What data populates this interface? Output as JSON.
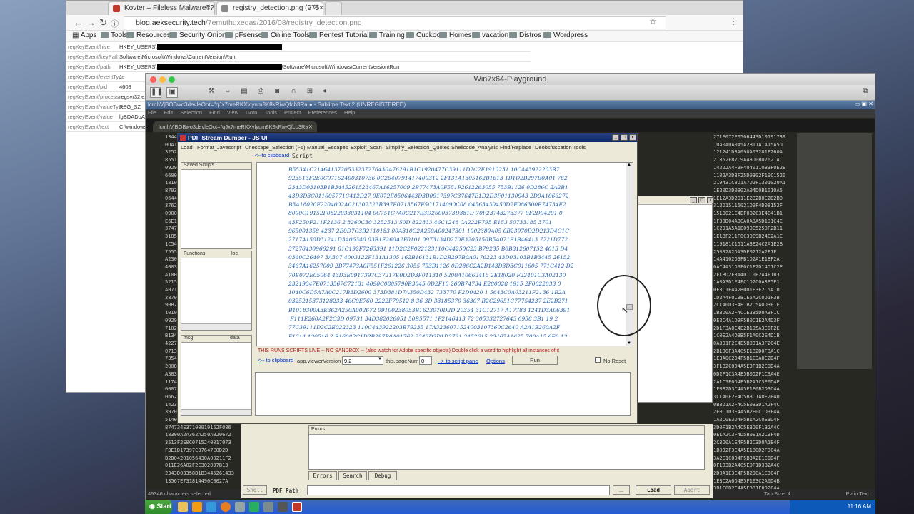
{
  "chrome": {
    "tabs": [
      {
        "label": "Kovter – Fileless Malware?? P"
      },
      {
        "label": "registry_detection.png (975×1"
      }
    ],
    "url_host": "blog.aeksecurity.tech",
    "url_path": "/7emuthuxeqas/2016/08/registry_detection.png",
    "bookmarks": [
      "Apps",
      "Tools",
      "Resources",
      "Security Onion",
      "pFsense",
      "Online Tools",
      "Pentest Tutorials",
      "Training",
      "Cuckoo",
      "Homes",
      "vacation",
      "Distros",
      "Wordpress"
    ],
    "registry_rows": [
      {
        "key": "regKeyEvent/hive",
        "value": "HKEY_USERS\\"
      },
      {
        "key": "regKeyEvent/keyPath",
        "value": "Software\\Microsoft\\Windows\\CurrentVersion\\Run"
      },
      {
        "key": "regKeyEvent/path",
        "value": "HKEY_USERS\\"
      },
      {
        "key": "regKeyEvent/eventType",
        "value": "1"
      },
      {
        "key": "regKeyEvent/pid",
        "value": "4608"
      },
      {
        "key": "regKeyEvent/process",
        "value": "regsvr32.exe"
      },
      {
        "key": "regKeyEvent/valueType",
        "value": "REG_SZ"
      },
      {
        "key": "regKeyEvent/value",
        "value": "lgBDADoA"
      },
      {
        "key": "regKeyEvent/text",
        "value": "C:\\windows"
      }
    ],
    "registry_path_suffix": "\\Software\\Microsoft\\Windows\\CurrentVersion\\Run"
  },
  "vm": {
    "title": "Win7x64-Playground"
  },
  "sublime": {
    "title": "lcmhVjBOBwo3devleOot=\"qJx7meRKXvlyum8K8kRiwQfcb3Ra ● - Sublime Text 2 (UNREGISTERED)",
    "menu": [
      "File",
      "Edit",
      "Selection",
      "Find",
      "View",
      "Goto",
      "Tools",
      "Project",
      "Preferences",
      "Help"
    ],
    "tab": "lcmhVjBOBwo3devleOot=\"qJx7meRKXvlyum8K8kRiwQfcb3Ra",
    "status_left": "49346 characters selected",
    "status_tab": "Tab Size: 4",
    "status_syntax": "Plain Text",
    "left_column": "1344\n0DA1\n3252\n8551\n0929\n6600\n1810\n8793\n0644\n3762\n0900\nE6E1\n3747\n3185\n1C54\n7555\nA230\n4003\nA100\n5215\nA071\n2870\n90B7\n1010\n0929\n7102\nB134\n4227\n0713\n7354\n2008\nA383\n1174\n0007\n0662\n1423\n3970\n5140\n874734E37100919152F086\n18300A2A362A250A020672\n3513F2E0C0715240017073\nF3E1D17397C37647E0D2D\nB2D04201056430A00211F2\n011E26A02F2C302097B13\n2343D03358B1B3445261433\n13567E731814490C0027A",
    "right_column": "271E072E0506443D10191739\n10A0A0A0A5A2B11A1A15A5D\n121241D3A090A03281E260A\n21852F87C9A48D0B07621AC\n14222A4F3F4040110B3F0E2E\n1102A3D3F25D9302F19C1520\n219431C8D1A7D2F1301020A1\n1E20D3D0B02A04D0B1010A5\n1E12A3D2D11E2B2B0E2D2B0\n312D15115021D9F4D0B152F\n151D021C4EF0B2C3E4C41B1\n1F38D04A3CA0A3A5D191C4C\n1C2D1A5A1E09DE5250F2B11\n1E18F211F0C3DE9B24C2A1E\n119181C1511A3E24C2A1E2B\n2509282DA3DE0212A2F1E\n14A4102D3FB1D2A1E18F2A\n0AC4A31D9F0C1F2D14D1C2E\n2F1BD2F3A4D1C0E2A4F1B3\n1A0A3D1E4FC1D2C0A3B5E1\n0F3C1E4A2B0D1F3E2C5A1D\n1D2A4F0C3B1E5A2C0D1F3B\n2C1A0D3F4E1B2C5A0D3E1F\n1B3D0A2F4C1E2B5D0A3F1C\n0E2C4A1D3F5B0C1E2A4D3F\n2D1F3A0C4E2B1D5A3C0F2E\n1C0E2A4D3B5F1A0C2E4D1B\n0A3D1F2C4E5B0D1A3F2C4E\n2B1D0F3A4C5E1B2D0F3A1C\n1E3A0C2D4F5B1E3A0C2D4F\n3F1B2C0D4A5E3F1B2C0D4A\n0D2F1C3A4E5B0D2F1C3A4E\n2A1C3E0D4F5B2A1C3E0D4F\n1F0B2D3C4A5E1F0B2D3C4A\n3C1A0F2E4D5B3C1A0F2E4D\n0B3D1A2F4C5E0B3D1A2F4C\n2E0C1D3F4A5B2E0C1D3F4A\n1A2C0E3D4F5B1A2C0E3D4F\n3D0F1B2A4C5E3D0F1B2A4C\n0E1A2C3F4D5B0E1A2C3F4D\n2C3D0A1E4F5B2C3D0A1E4F\n1B0D2F3C4A5E1B0D2F3C4A\n3A2E1C0D4F5B3A2E1C0D4F\n0F1D3B2A4C5E0F1D3B2A4C\n2D0A1E3C4F5B2D0A1E3C4F\n1E3C2A0D4B5F1E3C2A0D4B\n3B1F0D2C4A5E3B1F0D2C4A"
  },
  "psd": {
    "title": "PDF Stream Dumper - JS UI",
    "menu": [
      "Load",
      "Format_Javascript",
      "Unescape_Selection (F6)",
      "Manual_Escapes",
      "Exploit_Scan",
      "Simplify_Selection_Quotes",
      "Shellcode_Analysis",
      "Find/Replace",
      "Deobsfuscation Tools"
    ],
    "to_clipboard": "<--to clipboard",
    "script_label": "Script",
    "saved_scripts": "Saved Scripts",
    "functions_col": "Functions",
    "loc_col": "loc",
    "msg_col": "msg",
    "data_col": "data",
    "script_lines": "B55341C2146413720533237276430A76291B1C1920477C39111D2C2E1910231 10C443922203B7\n923513F2E0C07152400310736 0C2640791417400312 2F131A1305162B1613 1B1D2B297B0A01 762\n2343D03103B1B3445261523467A16257009 2B77473A0F551F2612263055 753B1126 0D286C 2A2B1\n43D3D3C011605771C412D27 0E072E0506443D3B0917397C37647E1D2D3F01130943 2D0A1066272\nB3A18020F2204002A021302323B397E0713567F5C1714090C08 04563430450D2F086300B74734E2\n8000C19152F0822033031104 0C751C7A0C217B3D2600373D381D 70F23743273377 0F2D04201 0\n43F250F211F2136 2 8260C30 3252513 50D 822833 46C1248 0A222F795 E153 50733185 3701\n965001358 4237 2E0D7C3B2110183 00A310C2A250A00247301 1002380A05 0B23070D2D213D4C1C\n2717A150D31241D3A06340 03B1E260A2F0101 0973134D270F3205150B5A071F1B46413 7221D772\n37276430966291 81C192F7263391 11D2C2F022123110C44250C23 B79235 B0B312607152 4013 D4\n0360C26407 3A307 4003122F131A1305 162B16131E1D2B297B0A0176223 43D03103B1B3445 26152\n3467A16257009 2B77473A0F551F261226 3055 753B1126 0D286C2A2B143D3D3C011605 771C412 D2\n70E072E05064 43D3E0917397C37217E0D2D3F011310 5200A10662415 2E18020 F22401C3A02130\n23219347E0713567C72131 4090C0805790B3045 0D2F10 260B74734 E280028 1915 2F0822033 0\n1040C6D5A7A0C217B3D2600 373D381D7A350D432 733770 F2D0420 1 5643C0A03211F2136 1E2A\n0325215373128233 46C0E760 2222F79512 8 36 3D 33185370 36307 B2C29651C77754237 2E2B271\nB1018300A3E362A250A002672 09100238053B1623070D2D 20354 31C12717 A17783 1241D3A06391\n F111E260A2F2C3D 09731 34D382026051 50B5571 1F2146413 72 305332727643 0958 3B1 19 2\n77C39111D2C2E022323 110C443922203B79235 17A3236071524003107360C2640 A2A1E260A2F\nF1314 130516 2 B16082C1D2B297B0A01762 2343D3D1D2721 3452615 23467A1625 700A15 6F8 13\n F551F2612263 055753 B1126 0D286C2 A2B143D3D3C0 153065 D1C41 2D270 E072E0506443 B1"
  },
  "psd_bottom": {
    "warning": "THIS RUNS SCRIPTS LIVE -- NO SANDBOX -- (also watch for Adobe specific objects) Double click a word to highlight all instances of it",
    "clipboard": "<-- to clipboard",
    "viewer_label": "app.viewerVersion",
    "viewer_value": "9.2",
    "pagenum_label": "this.pageNum",
    "pagenum_value": "0",
    "to_script_pane": "--> to script pane",
    "options": "Options",
    "run": "Run",
    "no_reset": "No Reset"
  },
  "shell_tabs": {
    "shell": "Shell",
    "pdf_path": "PDF Path",
    "load": "Load",
    "abort": "Abort",
    "dots": "...",
    "errors_header": "Errors",
    "tab_errors": "Errors",
    "tab_search": "Search",
    "tab_debug": "Debug"
  },
  "taskbar": {
    "start": "Start",
    "time": "11:16 AM"
  }
}
